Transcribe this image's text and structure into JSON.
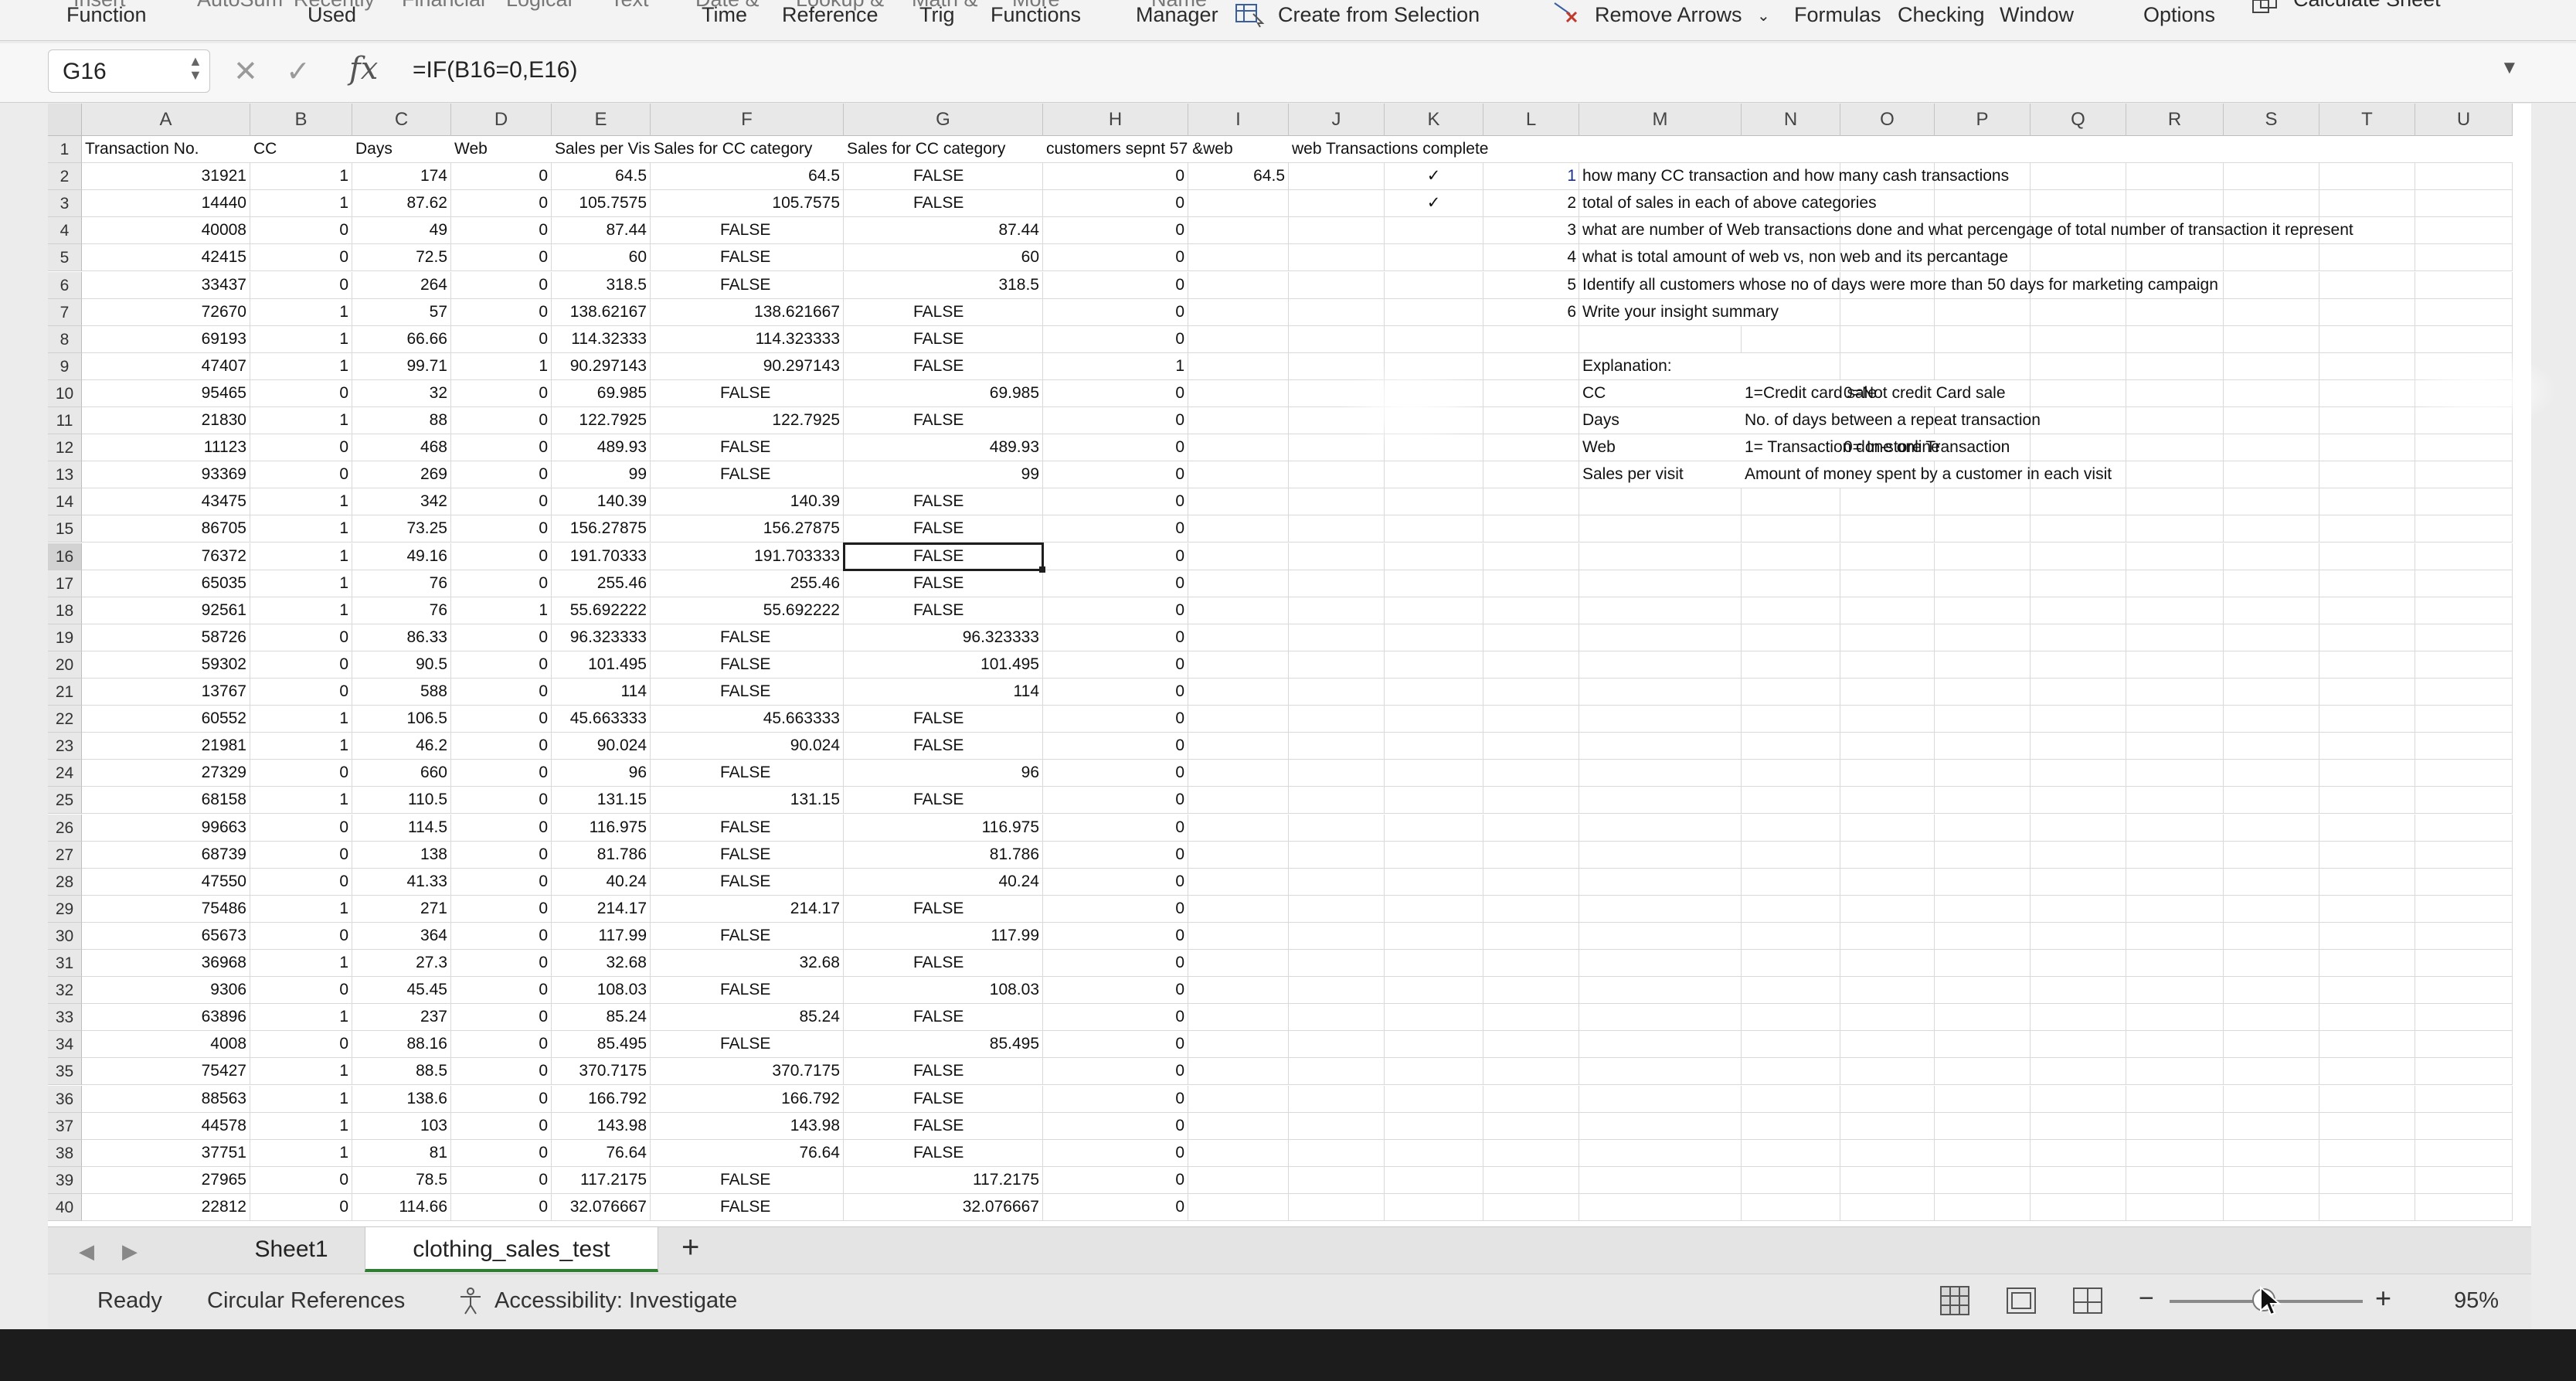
{
  "ribbon": {
    "items": [
      {
        "label": "Function"
      },
      {
        "label": "Used"
      },
      {
        "label": "Time"
      },
      {
        "label": "Reference"
      },
      {
        "label": "Trig"
      },
      {
        "label": "Functions"
      },
      {
        "label": "Manager"
      },
      {
        "label": "Create from Selection"
      },
      {
        "label": "Remove Arrows"
      },
      {
        "label": "Formulas"
      },
      {
        "label": "Checking"
      },
      {
        "label": "Window"
      },
      {
        "label": "Options"
      }
    ],
    "top_cut": [
      "Insert",
      "AutoSum",
      "Recently",
      "Financial",
      "Logical",
      "Text",
      "Date &",
      "Lookup &",
      "Math &",
      "More",
      "Name",
      "Calculate Sheet"
    ]
  },
  "formula_bar": {
    "name_box": "G16",
    "formula": "=IF(B16=0,E16)",
    "fx": "fx"
  },
  "columns": [
    "A",
    "B",
    "C",
    "D",
    "E",
    "F",
    "G",
    "H",
    "I",
    "J",
    "K",
    "L",
    "M",
    "N",
    "O",
    "P",
    "Q",
    "R",
    "S",
    "T",
    "U"
  ],
  "rows": [
    {
      "n": "1",
      "A": "Transaction No.",
      "B": "CC",
      "C": "Days",
      "D": "Web",
      "E": "Sales per Vis",
      "F": "Sales for CC category",
      "G": "Sales for CC category",
      "H": "customers sepnt 57 &web",
      "I": "",
      "J": "web Transactions complete",
      "K": "",
      "M": ""
    },
    {
      "n": "2",
      "A": "31921",
      "B": "1",
      "C": "174",
      "D": "0",
      "E": "64.5",
      "F": "64.5",
      "G": "FALSE",
      "H": "0",
      "I": "64.5",
      "K": "✓",
      "Mn": "1",
      "M": "how many CC transaction and how many cash transactions"
    },
    {
      "n": "3",
      "A": "14440",
      "B": "1",
      "C": "87.62",
      "D": "0",
      "E": "105.7575",
      "F": "105.7575",
      "G": "FALSE",
      "H": "0",
      "K": "✓",
      "Mn": "2",
      "M": "total of sales in each of above categories"
    },
    {
      "n": "4",
      "A": "40008",
      "B": "0",
      "C": "49",
      "D": "0",
      "E": "87.44",
      "F": "FALSE",
      "G": "87.44",
      "H": "0",
      "Mn": "3",
      "M": "what are number of Web transactions done and what percengage of total number of transaction it represent"
    },
    {
      "n": "5",
      "A": "42415",
      "B": "0",
      "C": "72.5",
      "D": "0",
      "E": "60",
      "F": "FALSE",
      "G": "60",
      "H": "0",
      "Mn": "4",
      "M": "what is total amount of web vs, non web and its percantage"
    },
    {
      "n": "6",
      "A": "33437",
      "B": "0",
      "C": "264",
      "D": "0",
      "E": "318.5",
      "F": "FALSE",
      "G": "318.5",
      "H": "0",
      "Mn": "5",
      "M": "Identify all customers whose no of days were more than 50 days for marketing campaign"
    },
    {
      "n": "7",
      "A": "72670",
      "B": "1",
      "C": "57",
      "D": "0",
      "E": "138.62167",
      "F": "138.621667",
      "G": "FALSE",
      "H": "0",
      "Mn": "6",
      "M": "Write your insight summary"
    },
    {
      "n": "8",
      "A": "69193",
      "B": "1",
      "C": "66.66",
      "D": "0",
      "E": "114.32333",
      "F": "114.323333",
      "G": "FALSE",
      "H": "0"
    },
    {
      "n": "9",
      "A": "47407",
      "B": "1",
      "C": "99.71",
      "D": "1",
      "E": "90.297143",
      "F": "90.297143",
      "G": "FALSE",
      "H": "1",
      "M": "Explanation:"
    },
    {
      "n": "10",
      "A": "95465",
      "B": "0",
      "C": "32",
      "D": "0",
      "E": "69.985",
      "F": "FALSE",
      "G": "69.985",
      "H": "0",
      "M": "CC",
      "N": "1=Credit card sale",
      "O": "0=Not credit Card sale"
    },
    {
      "n": "11",
      "A": "21830",
      "B": "1",
      "C": "88",
      "D": "0",
      "E": "122.7925",
      "F": "122.7925",
      "G": "FALSE",
      "H": "0",
      "M": "Days",
      "N": "No. of days between a repeat transaction"
    },
    {
      "n": "12",
      "A": "11123",
      "B": "0",
      "C": "468",
      "D": "0",
      "E": "489.93",
      "F": "FALSE",
      "G": "489.93",
      "H": "0",
      "M": "Web",
      "N": "1= Transaction done online",
      "O": "0= In-store Transaction"
    },
    {
      "n": "13",
      "A": "93369",
      "B": "0",
      "C": "269",
      "D": "0",
      "E": "99",
      "F": "FALSE",
      "G": "99",
      "H": "0",
      "M": "Sales per visit",
      "N": "Amount of money spent by a customer in each visit"
    },
    {
      "n": "14",
      "A": "43475",
      "B": "1",
      "C": "342",
      "D": "0",
      "E": "140.39",
      "F": "140.39",
      "G": "FALSE",
      "H": "0"
    },
    {
      "n": "15",
      "A": "86705",
      "B": "1",
      "C": "73.25",
      "D": "0",
      "E": "156.27875",
      "F": "156.27875",
      "G": "FALSE",
      "H": "0"
    },
    {
      "n": "16",
      "A": "76372",
      "B": "1",
      "C": "49.16",
      "D": "0",
      "E": "191.70333",
      "F": "191.703333",
      "G": "FALSE",
      "H": "0"
    },
    {
      "n": "17",
      "A": "65035",
      "B": "1",
      "C": "76",
      "D": "0",
      "E": "255.46",
      "F": "255.46",
      "G": "FALSE",
      "H": "0"
    },
    {
      "n": "18",
      "A": "92561",
      "B": "1",
      "C": "76",
      "D": "1",
      "E": "55.692222",
      "F": "55.692222",
      "G": "FALSE",
      "H": "0"
    },
    {
      "n": "19",
      "A": "58726",
      "B": "0",
      "C": "86.33",
      "D": "0",
      "E": "96.323333",
      "F": "FALSE",
      "G": "96.323333",
      "H": "0"
    },
    {
      "n": "20",
      "A": "59302",
      "B": "0",
      "C": "90.5",
      "D": "0",
      "E": "101.495",
      "F": "FALSE",
      "G": "101.495",
      "H": "0"
    },
    {
      "n": "21",
      "A": "13767",
      "B": "0",
      "C": "588",
      "D": "0",
      "E": "114",
      "F": "FALSE",
      "G": "114",
      "H": "0"
    },
    {
      "n": "22",
      "A": "60552",
      "B": "1",
      "C": "106.5",
      "D": "0",
      "E": "45.663333",
      "F": "45.663333",
      "G": "FALSE",
      "H": "0"
    },
    {
      "n": "23",
      "A": "21981",
      "B": "1",
      "C": "46.2",
      "D": "0",
      "E": "90.024",
      "F": "90.024",
      "G": "FALSE",
      "H": "0"
    },
    {
      "n": "24",
      "A": "27329",
      "B": "0",
      "C": "660",
      "D": "0",
      "E": "96",
      "F": "FALSE",
      "G": "96",
      "H": "0"
    },
    {
      "n": "25",
      "A": "68158",
      "B": "1",
      "C": "110.5",
      "D": "0",
      "E": "131.15",
      "F": "131.15",
      "G": "FALSE",
      "H": "0"
    },
    {
      "n": "26",
      "A": "99663",
      "B": "0",
      "C": "114.5",
      "D": "0",
      "E": "116.975",
      "F": "FALSE",
      "G": "116.975",
      "H": "0"
    },
    {
      "n": "27",
      "A": "68739",
      "B": "0",
      "C": "138",
      "D": "0",
      "E": "81.786",
      "F": "FALSE",
      "G": "81.786",
      "H": "0"
    },
    {
      "n": "28",
      "A": "47550",
      "B": "0",
      "C": "41.33",
      "D": "0",
      "E": "40.24",
      "F": "FALSE",
      "G": "40.24",
      "H": "0"
    },
    {
      "n": "29",
      "A": "75486",
      "B": "1",
      "C": "271",
      "D": "0",
      "E": "214.17",
      "F": "214.17",
      "G": "FALSE",
      "H": "0"
    },
    {
      "n": "30",
      "A": "65673",
      "B": "0",
      "C": "364",
      "D": "0",
      "E": "117.99",
      "F": "FALSE",
      "G": "117.99",
      "H": "0"
    },
    {
      "n": "31",
      "A": "36968",
      "B": "1",
      "C": "27.3",
      "D": "0",
      "E": "32.68",
      "F": "32.68",
      "G": "FALSE",
      "H": "0"
    },
    {
      "n": "32",
      "A": "9306",
      "B": "0",
      "C": "45.45",
      "D": "0",
      "E": "108.03",
      "F": "FALSE",
      "G": "108.03",
      "H": "0"
    },
    {
      "n": "33",
      "A": "63896",
      "B": "1",
      "C": "237",
      "D": "0",
      "E": "85.24",
      "F": "85.24",
      "G": "FALSE",
      "H": "0"
    },
    {
      "n": "34",
      "A": "4008",
      "B": "0",
      "C": "88.16",
      "D": "0",
      "E": "85.495",
      "F": "FALSE",
      "G": "85.495",
      "H": "0"
    },
    {
      "n": "35",
      "A": "75427",
      "B": "1",
      "C": "88.5",
      "D": "0",
      "E": "370.7175",
      "F": "370.7175",
      "G": "FALSE",
      "H": "0"
    },
    {
      "n": "36",
      "A": "88563",
      "B": "1",
      "C": "138.6",
      "D": "0",
      "E": "166.792",
      "F": "166.792",
      "G": "FALSE",
      "H": "0"
    },
    {
      "n": "37",
      "A": "44578",
      "B": "1",
      "C": "103",
      "D": "0",
      "E": "143.98",
      "F": "143.98",
      "G": "FALSE",
      "H": "0"
    },
    {
      "n": "38",
      "A": "37751",
      "B": "1",
      "C": "81",
      "D": "0",
      "E": "76.64",
      "F": "76.64",
      "G": "FALSE",
      "H": "0"
    },
    {
      "n": "39",
      "A": "27965",
      "B": "0",
      "C": "78.5",
      "D": "0",
      "E": "117.2175",
      "F": "FALSE",
      "G": "117.2175",
      "H": "0"
    },
    {
      "n": "40",
      "A": "22812",
      "B": "0",
      "C": "114.66",
      "D": "0",
      "E": "32.076667",
      "F": "FALSE",
      "G": "32.076667",
      "H": "0"
    }
  ],
  "sheet_tabs": {
    "tabs": [
      "Sheet1",
      "clothing_sales_test"
    ],
    "active": "clothing_sales_test",
    "add": "+"
  },
  "status_bar": {
    "ready": "Ready",
    "circular": "Circular References",
    "accessibility": "Accessibility: Investigate",
    "zoom_minus": "−",
    "zoom_plus": "+",
    "zoom": "95%"
  },
  "colors": {
    "selection": "#1e1e1e",
    "active_tab_underline": "#2f7d32",
    "grid_line": "#d9d9d9",
    "header_bg": "#e8e8e8"
  },
  "icons": [
    "spin-arrows-icon",
    "cancel-icon",
    "enter-icon",
    "fx-icon",
    "create-from-selection-icon",
    "remove-arrows-icon",
    "calculate-sheet-icon",
    "tab-prev-icon",
    "tab-next-icon",
    "accessibility-icon",
    "normal-view-icon",
    "page-layout-view-icon",
    "page-break-view-icon",
    "chevron-down-icon",
    "mouse-pointer-icon"
  ]
}
